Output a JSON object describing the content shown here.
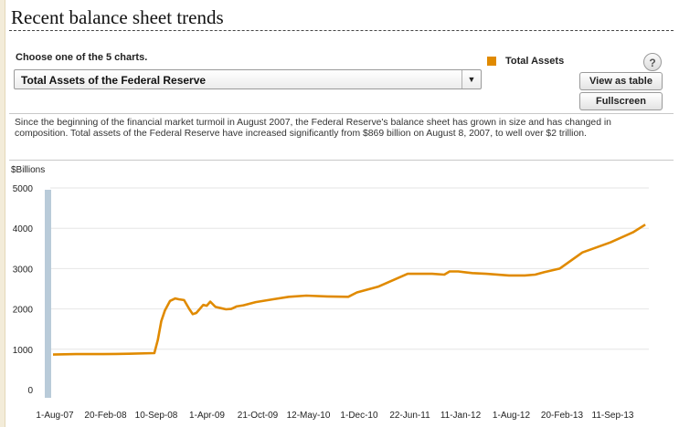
{
  "header": {
    "title": "Recent balance sheet trends"
  },
  "controls": {
    "choose_label": "Choose one of the 5 charts.",
    "selected_chart": "Total Assets of the Federal Reserve",
    "help_label": "?",
    "view_table_label": "View as table",
    "fullscreen_label": "Fullscreen"
  },
  "legend": {
    "label": "Total Assets",
    "color": "#e08a00"
  },
  "description": "Since the beginning of the financial market turmoil in August 2007, the Federal Reserve's balance sheet has grown in size and has changed in composition. Total assets of the Federal Reserve have increased significantly from $869 billion on August 8, 2007, to well over $2 trillion.",
  "chart_data": {
    "type": "line",
    "ylabel": "$Billions",
    "ylim": [
      0,
      5000
    ],
    "yticks": [
      0,
      1000,
      2000,
      3000,
      4000,
      5000
    ],
    "xtick_labels": [
      "1-Aug-07",
      "20-Feb-08",
      "10-Sep-08",
      "1-Apr-09",
      "21-Oct-09",
      "12-May-10",
      "1-Dec-10",
      "22-Jun-11",
      "11-Jan-12",
      "1-Aug-12",
      "20-Feb-13",
      "11-Sep-13"
    ],
    "grid": true,
    "line_color": "#e08a00",
    "series": [
      {
        "name": "Total Assets",
        "x": [
          "2007-08-01",
          "2007-11-01",
          "2008-02-20",
          "2008-06-01",
          "2008-09-10",
          "2008-09-24",
          "2008-10-08",
          "2008-10-22",
          "2008-11-12",
          "2008-12-03",
          "2008-12-17",
          "2009-01-07",
          "2009-01-28",
          "2009-02-11",
          "2009-02-25",
          "2009-03-11",
          "2009-03-25",
          "2009-04-08",
          "2009-04-22",
          "2009-05-13",
          "2009-06-03",
          "2009-06-24",
          "2009-07-15",
          "2009-08-05",
          "2009-09-02",
          "2009-10-21",
          "2009-12-30",
          "2010-03-03",
          "2010-05-12",
          "2010-08-04",
          "2010-10-27",
          "2010-12-01",
          "2011-02-23",
          "2011-06-22",
          "2011-09-28",
          "2011-11-16",
          "2011-12-07",
          "2012-01-11",
          "2012-03-07",
          "2012-05-02",
          "2012-08-01",
          "2012-10-03",
          "2012-11-14",
          "2012-12-19",
          "2013-02-20",
          "2013-05-22",
          "2013-09-11",
          "2013-12-11",
          "2014-01-29"
        ],
        "values": [
          869,
          880,
          880,
          890,
          905,
          1230,
          1700,
          1960,
          2200,
          2260,
          2240,
          2220,
          2000,
          1870,
          1900,
          2000,
          2100,
          2080,
          2180,
          2050,
          2020,
          1990,
          2000,
          2060,
          2090,
          2170,
          2240,
          2300,
          2330,
          2310,
          2300,
          2410,
          2550,
          2870,
          2870,
          2850,
          2930,
          2930,
          2890,
          2870,
          2830,
          2830,
          2850,
          2910,
          3000,
          3400,
          3650,
          3900,
          4090
        ]
      }
    ]
  }
}
